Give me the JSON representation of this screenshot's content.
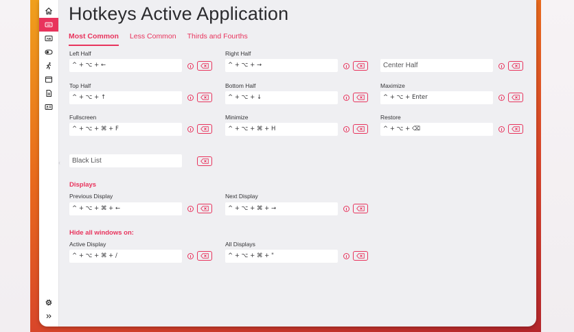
{
  "window": {
    "title": "Hotkeys Active Application"
  },
  "sidebar": {
    "items": [
      {
        "icon": "home-icon",
        "active": false
      },
      {
        "icon": "keyboard-icon",
        "active": true
      },
      {
        "icon": "ab-box-icon",
        "active": false
      },
      {
        "icon": "toggle-icon",
        "active": false
      },
      {
        "icon": "running-figure-icon",
        "active": false
      },
      {
        "icon": "window-icon",
        "active": false
      },
      {
        "icon": "document-icon",
        "active": false
      },
      {
        "icon": "id-card-icon",
        "active": false
      }
    ],
    "settings_icon": "gear-icon",
    "expand_icon": "double-chevron-right-icon"
  },
  "tabs": [
    {
      "label": "Most Common",
      "active": true
    },
    {
      "label": "Less Common",
      "active": false
    },
    {
      "label": "Thirds and Fourths",
      "active": false
    }
  ],
  "hotkeys": {
    "left_half": {
      "label": "Left Half",
      "value": "^ + ⌥ + ←"
    },
    "right_half": {
      "label": "Right Half",
      "value": "^ + ⌥ + →"
    },
    "center_half": {
      "label": "",
      "value": "",
      "placeholder": "Center Half"
    },
    "top_half": {
      "label": "Top Half",
      "value": "^ + ⌥ + ↑"
    },
    "bottom_half": {
      "label": "Bottom Half",
      "value": "^ + ⌥ + ↓"
    },
    "maximize": {
      "label": "Maximize",
      "value": "^ + ⌥ + Enter"
    },
    "fullscreen": {
      "label": "Fullscreen",
      "value": "^ + ⌥ + ⌘ + F"
    },
    "minimize": {
      "label": "Minimize",
      "value": "^ + ⌥ + ⌘ + H"
    },
    "restore": {
      "label": "Restore",
      "value": "^ + ⌥ + ⌫"
    },
    "black_list": {
      "label": "",
      "value": "",
      "placeholder": "Black List"
    }
  },
  "displays": {
    "heading": "Displays",
    "previous": {
      "label": "Previous Display",
      "value": "^ + ⌥ + ⌘ + ←"
    },
    "next": {
      "label": "Next Display",
      "value": "^ + ⌥ + ⌘ + →"
    }
  },
  "hide_windows": {
    "heading": "Hide all windows on:",
    "active": {
      "label": "Active Display",
      "value": "^ + ⌥ + ⌘ + /"
    },
    "all": {
      "label": "All Displays",
      "value": "^ + ⌥ + ⌘ + \""
    }
  },
  "colors": {
    "accent": "#e8335c",
    "window_bg": "#efeff2",
    "field_bg": "#ffffff"
  }
}
